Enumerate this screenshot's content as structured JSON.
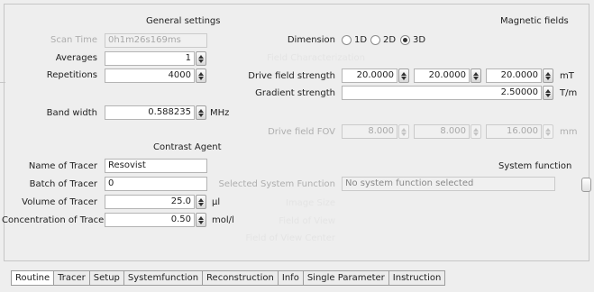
{
  "general": {
    "header": "General settings",
    "scan_time_label": "Scan Time",
    "scan_time_value": "0h1m26s169ms",
    "averages_label": "Averages",
    "averages_value": "1",
    "repetitions_label": "Repetitions",
    "repetitions_value": "4000",
    "bandwidth_label": "Band width",
    "bandwidth_value": "0.588235",
    "bandwidth_unit": "MHz"
  },
  "magnetic": {
    "header": "Magnetic fields",
    "dimension_label": "Dimension",
    "dimension_options": [
      "1D",
      "2D",
      "3D"
    ],
    "dimension_selected": "3D",
    "ghost_label": "Field Characterization",
    "drive_field_label": "Drive field strength",
    "drive_field_values": [
      "20.0000",
      "20.0000",
      "20.0000"
    ],
    "drive_field_unit": "mT",
    "gradient_label": "Gradient strength",
    "gradient_value": "2.50000",
    "gradient_unit": "T/m",
    "fov_label": "Drive field FOV",
    "fov_values": [
      "8.000",
      "8.000",
      "16.000"
    ],
    "fov_unit": "mm"
  },
  "contrast": {
    "header": "Contrast Agent",
    "name_label": "Name of Tracer",
    "name_value": "Resovist",
    "batch_label": "Batch of Tracer",
    "batch_value": "0",
    "volume_label": "Volume of Tracer",
    "volume_value": "25.0",
    "volume_unit": "µl",
    "concentration_label": "Concentration of Tracer",
    "concentration_value": "0.50",
    "concentration_unit": "mol/l"
  },
  "system_function": {
    "header": "System function",
    "selected_label": "Selected System Function",
    "selected_value": "No system function selected",
    "ghost_rows": [
      "Image Size",
      "Field of View",
      "Field of View Center"
    ]
  },
  "tabs": [
    "Routine",
    "Tracer",
    "Setup",
    "Systemfunction",
    "Reconstruction",
    "Info",
    "Single Parameter",
    "Instruction"
  ],
  "active_tab": "Routine"
}
